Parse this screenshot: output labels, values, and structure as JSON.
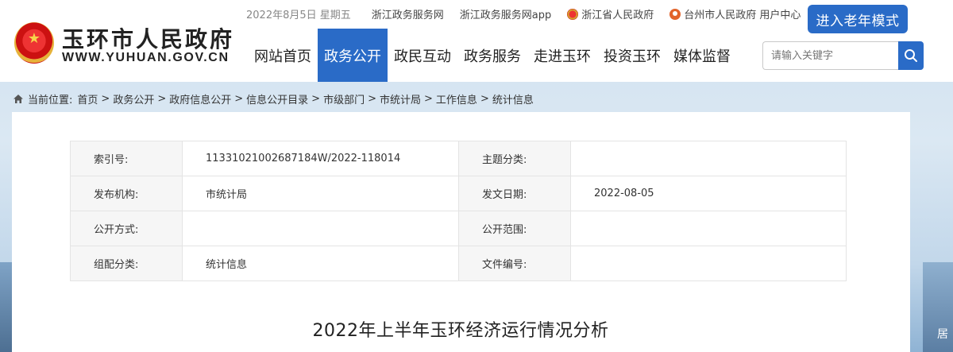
{
  "header": {
    "site_name_cn": "玉环市人民政府",
    "site_name_en": "WWW.YUHUAN.GOV.CN",
    "date": "2022年8月5日 星期五",
    "top_links": [
      "浙江政务服务网",
      "浙江政务服务网app",
      "浙江省人民政府",
      "台州市人民政府 用户中心"
    ],
    "elder_mode_label": "进入老年模式",
    "nav": [
      "网站首页",
      "政务公开",
      "政民互动",
      "政务服务",
      "走进玉环",
      "投资玉环",
      "媒体监督"
    ],
    "nav_active_index": 1,
    "search_placeholder": "请输入关键字"
  },
  "breadcrumb": {
    "prefix": "当前位置:",
    "items": [
      "首页",
      "政务公开",
      "政府信息公开",
      "信息公开目录",
      "市级部门",
      "市统计局",
      "工作信息",
      "统计信息"
    ],
    "separator": ">"
  },
  "meta_table": [
    {
      "label1": "索引号:",
      "value1": "11331021002687184W/2022-118014",
      "label2": "主题分类:",
      "value2": ""
    },
    {
      "label1": "发布机构:",
      "value1": "市统计局",
      "label2": "发文日期:",
      "value2": "2022-08-05"
    },
    {
      "label1": "公开方式:",
      "value1": "",
      "label2": "公开范围:",
      "value2": ""
    },
    {
      "label1": "组配分类:",
      "value1": "统计信息",
      "label2": "文件编号:",
      "value2": ""
    }
  ],
  "document_title": "2022年上半年玉环经济运行情况分析",
  "side_char": "居",
  "colors": {
    "accent": "#2a6bc7",
    "nav_active_bg": "#2a6bc7"
  }
}
